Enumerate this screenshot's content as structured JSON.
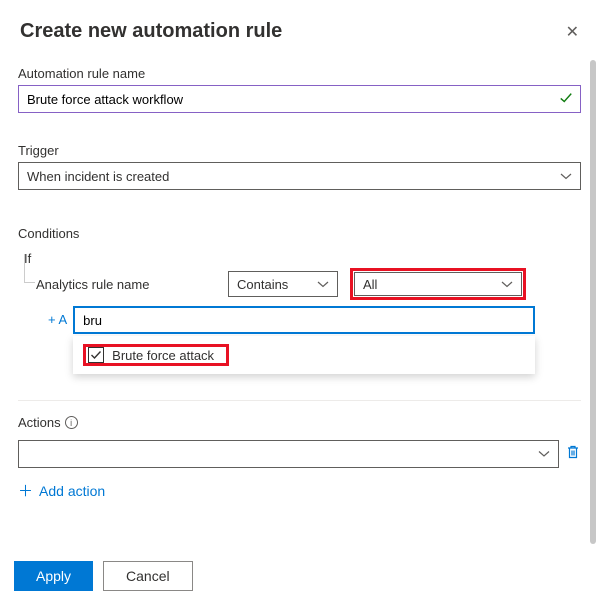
{
  "header": {
    "title": "Create new automation rule"
  },
  "ruleName": {
    "label": "Automation rule name",
    "value": "Brute force attack workflow"
  },
  "trigger": {
    "label": "Trigger",
    "value": "When incident is created"
  },
  "conditions": {
    "label": "Conditions",
    "if": "If",
    "fieldLabel": "Analytics rule name",
    "operator": "Contains",
    "valueAll": "All",
    "searchValue": "bru",
    "option": "Brute force attack",
    "addLink": "+ A"
  },
  "actions": {
    "label": "Actions",
    "addAction": "Add action"
  },
  "footer": {
    "apply": "Apply",
    "cancel": "Cancel"
  }
}
